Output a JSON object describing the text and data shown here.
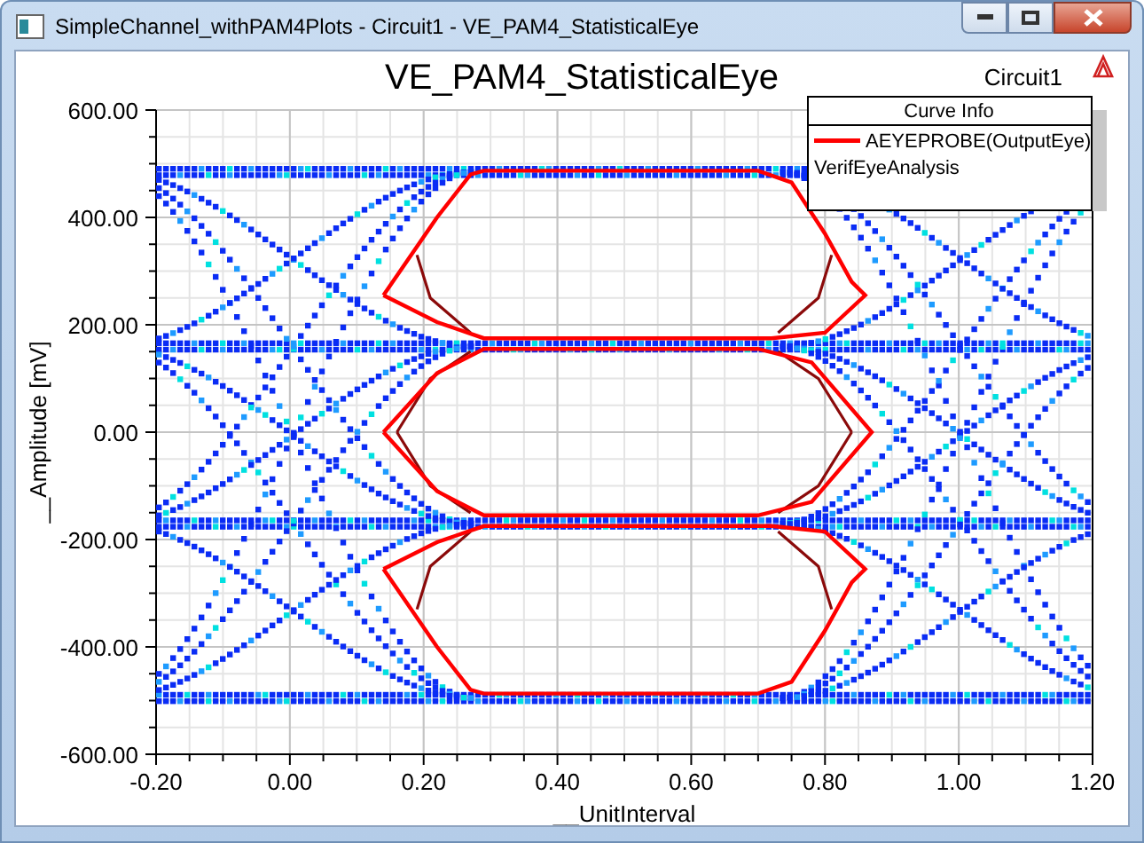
{
  "window": {
    "title": "SimpleChannel_withPAM4Plots - Circuit1 - VE_PAM4_StatisticalEye"
  },
  "plot": {
    "circuit_label": "Circuit1",
    "legend": {
      "header": "Curve Info",
      "entries": [
        {
          "label": "AEYEPROBE(OutputEye)",
          "color": "#ff0000"
        }
      ],
      "note": "VerifEyeAnalysis"
    },
    "chart_data": {
      "type": "line",
      "title": "VE_PAM4_StatisticalEye",
      "xlabel": "__UnitInterval",
      "ylabel": "__Amplitude [mV]",
      "xlim": [
        -0.2,
        1.2
      ],
      "ylim": [
        -600,
        600
      ],
      "grid": true,
      "xticks": [
        {
          "value": -0.2,
          "label": "-0.20"
        },
        {
          "value": 0,
          "label": "0.00"
        },
        {
          "value": 0.2,
          "label": "0.20"
        },
        {
          "value": 0.4,
          "label": "0.40"
        },
        {
          "value": 0.6,
          "label": "0.60"
        },
        {
          "value": 0.8,
          "label": "0.80"
        },
        {
          "value": 1.0,
          "label": "1.00"
        },
        {
          "value": 1.2,
          "label": "1.20"
        }
      ],
      "yticks": [
        {
          "value": 600,
          "label": "600.00"
        },
        {
          "value": 400,
          "label": "400.00"
        },
        {
          "value": 200,
          "label": "200.00"
        },
        {
          "value": 0,
          "label": "0.00"
        },
        {
          "value": -200,
          "label": "-200.00"
        },
        {
          "value": -400,
          "label": "-400.00"
        },
        {
          "value": -600,
          "label": "-600.00"
        }
      ]
    }
  }
}
